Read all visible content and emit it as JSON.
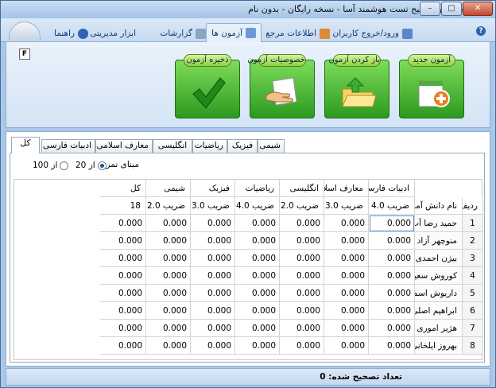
{
  "window": {
    "title": "نرم افزار تصحیح تست هوشمند آسا - نسخه رایگان - بدون نام",
    "min": "–",
    "max": "□",
    "close": "✕"
  },
  "menu": {
    "tabs": [
      {
        "label": "ورود/خروج کاربران"
      },
      {
        "label": "اطلاعات مرجع"
      },
      {
        "label": "آزمون ها"
      },
      {
        "label": "گزارشات"
      },
      {
        "label": "ابزار مدیریتی"
      },
      {
        "label": "راهنما"
      }
    ],
    "help": "?"
  },
  "ribbon": {
    "f_key": "F",
    "buttons": [
      {
        "label": "آزمون جدید"
      },
      {
        "label": "باز کردن آزمون"
      },
      {
        "label": "خصوصیات آزمون"
      },
      {
        "label": "ذخیره آزمون"
      }
    ]
  },
  "content": {
    "tabs": [
      {
        "label": "کل"
      },
      {
        "label": "ادبیات فارسی"
      },
      {
        "label": "معارف اسلامی"
      },
      {
        "label": "انگلیسی"
      },
      {
        "label": "ریاضیات"
      },
      {
        "label": "فیزیک"
      },
      {
        "label": "شیمی"
      }
    ],
    "basis_label": "مبنای نمره",
    "options": [
      {
        "label": "از 20",
        "selected": true
      },
      {
        "label": "از 100",
        "selected": false
      }
    ]
  },
  "grid": {
    "header1": [
      "ادبیات فارسی",
      "معارف اسلا.",
      "انگلیسی",
      "ریاضیات",
      "فیزیک",
      "شیمی",
      "کل"
    ],
    "header2": {
      "row_label": "ردیف",
      "name_label": "نام دانش آموز",
      "cols": [
        "ضریب 4.0",
        "ضریب 3.0",
        "ضریب 2.0",
        "ضریب 4.0",
        "ضریب 3.0",
        "ضریب 2.0",
        "18"
      ]
    },
    "rows": [
      {
        "n": "1",
        "name": "حمید رضا آب روشن",
        "vals": [
          "0.000",
          "0.000",
          "0.000",
          "0.000",
          "0.000",
          "0.000",
          "0.000"
        ]
      },
      {
        "n": "2",
        "name": "منوچهر آزاد دل",
        "vals": [
          "0.000",
          "0.000",
          "0.000",
          "0.000",
          "0.000",
          "0.000",
          "0.000"
        ]
      },
      {
        "n": "3",
        "name": "بیژن احمدی",
        "vals": [
          "0.000",
          "0.000",
          "0.000",
          "0.000",
          "0.000",
          "0.000",
          "0.000"
        ]
      },
      {
        "n": "4",
        "name": "کوروش سعیدی",
        "vals": [
          "0.000",
          "0.000",
          "0.000",
          "0.000",
          "0.000",
          "0.000",
          "0.000"
        ]
      },
      {
        "n": "5",
        "name": "داریوش اسماعیلی",
        "vals": [
          "0.000",
          "0.000",
          "0.000",
          "0.000",
          "0.000",
          "0.000",
          "0.000"
        ]
      },
      {
        "n": "6",
        "name": "ابراهیم اصلی",
        "vals": [
          "0.000",
          "0.000",
          "0.000",
          "0.000",
          "0.000",
          "0.000",
          "0.000"
        ]
      },
      {
        "n": "7",
        "name": "هژیر اموری",
        "vals": [
          "0.000",
          "0.000",
          "0.000",
          "0.000",
          "0.000",
          "0.000",
          "0.000"
        ]
      },
      {
        "n": "8",
        "name": "بهروز ایلخانی",
        "vals": [
          "0.000",
          "0.000",
          "0.000",
          "0.000",
          "0.000",
          "0.000",
          "0.000"
        ]
      }
    ]
  },
  "status": {
    "text": "تعداد تصحیح شده: 0"
  }
}
